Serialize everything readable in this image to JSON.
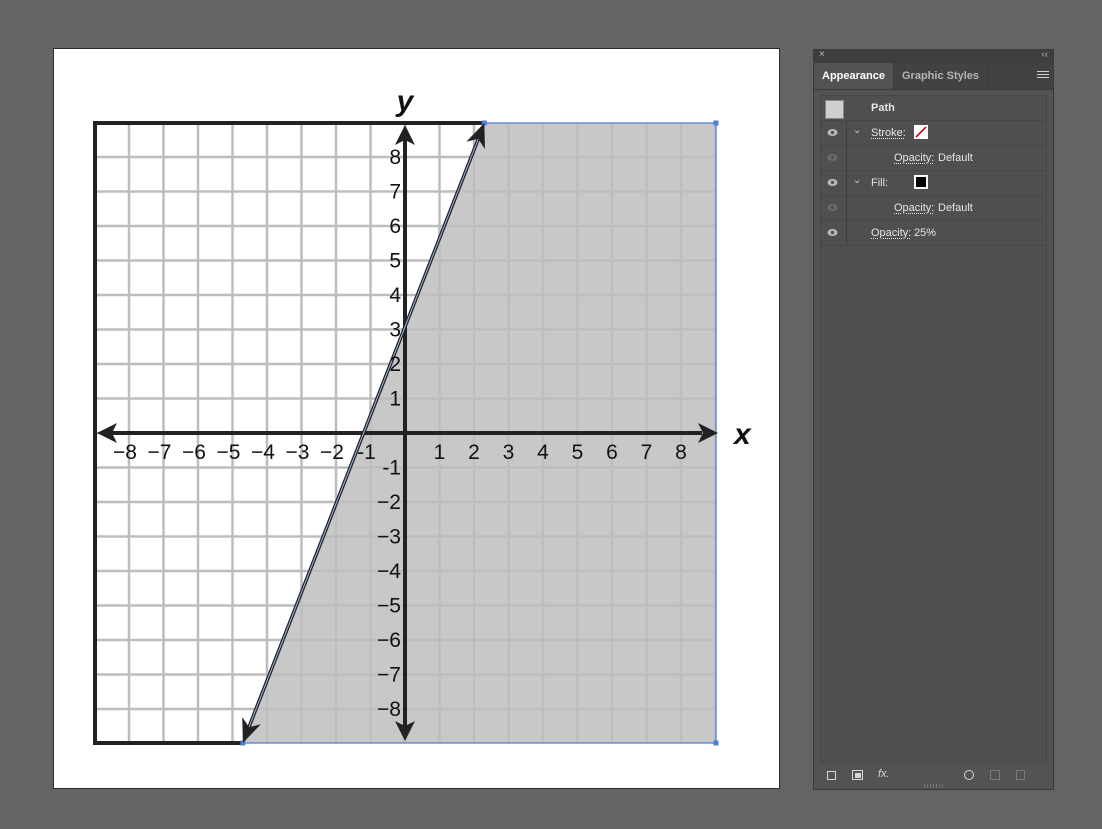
{
  "graph": {
    "y_axis_label": "y",
    "x_axis_label": "x",
    "x_tick_labels": [
      "−8",
      "−7",
      "−6",
      "−5",
      "−4",
      "−3",
      "−2",
      "-1",
      "1",
      "2",
      "3",
      "4",
      "5",
      "6",
      "7",
      "8"
    ],
    "y_tick_labels": [
      "8",
      "7",
      "6",
      "5",
      "4",
      "3",
      "2",
      "1",
      "-1",
      "−2",
      "−3",
      "−4",
      "−5",
      "−6",
      "−7",
      "−8"
    ],
    "x_ticks": [
      -8,
      -7,
      -6,
      -5,
      -4,
      -3,
      -2,
      -1,
      1,
      2,
      3,
      4,
      5,
      6,
      7,
      8
    ],
    "y_ticks": [
      8,
      7,
      6,
      5,
      4,
      3,
      2,
      1,
      -1,
      -2,
      -3,
      -4,
      -5,
      -6,
      -7,
      -8
    ],
    "line": {
      "x1": -4.7,
      "y1": -9,
      "x2": 2.3,
      "y2": 9
    },
    "colors": {
      "shade": "#c8c8c8",
      "selection": "#4f7fd6",
      "axis": "#222222",
      "grid": "#bdbdbd"
    }
  },
  "panel": {
    "tab_appearance": "Appearance",
    "tab_graphic_styles": "Graphic Styles",
    "path_label": "Path",
    "stroke_label": "Stroke:",
    "stroke_opacity_label": "Opacity:",
    "stroke_opacity_value": "Default",
    "fill_label": "Fill:",
    "fill_opacity_label": "Opacity:",
    "fill_opacity_value": "Default",
    "opacity_label": "Opacity:",
    "opacity_value": "25%",
    "fx_label": "fx."
  }
}
